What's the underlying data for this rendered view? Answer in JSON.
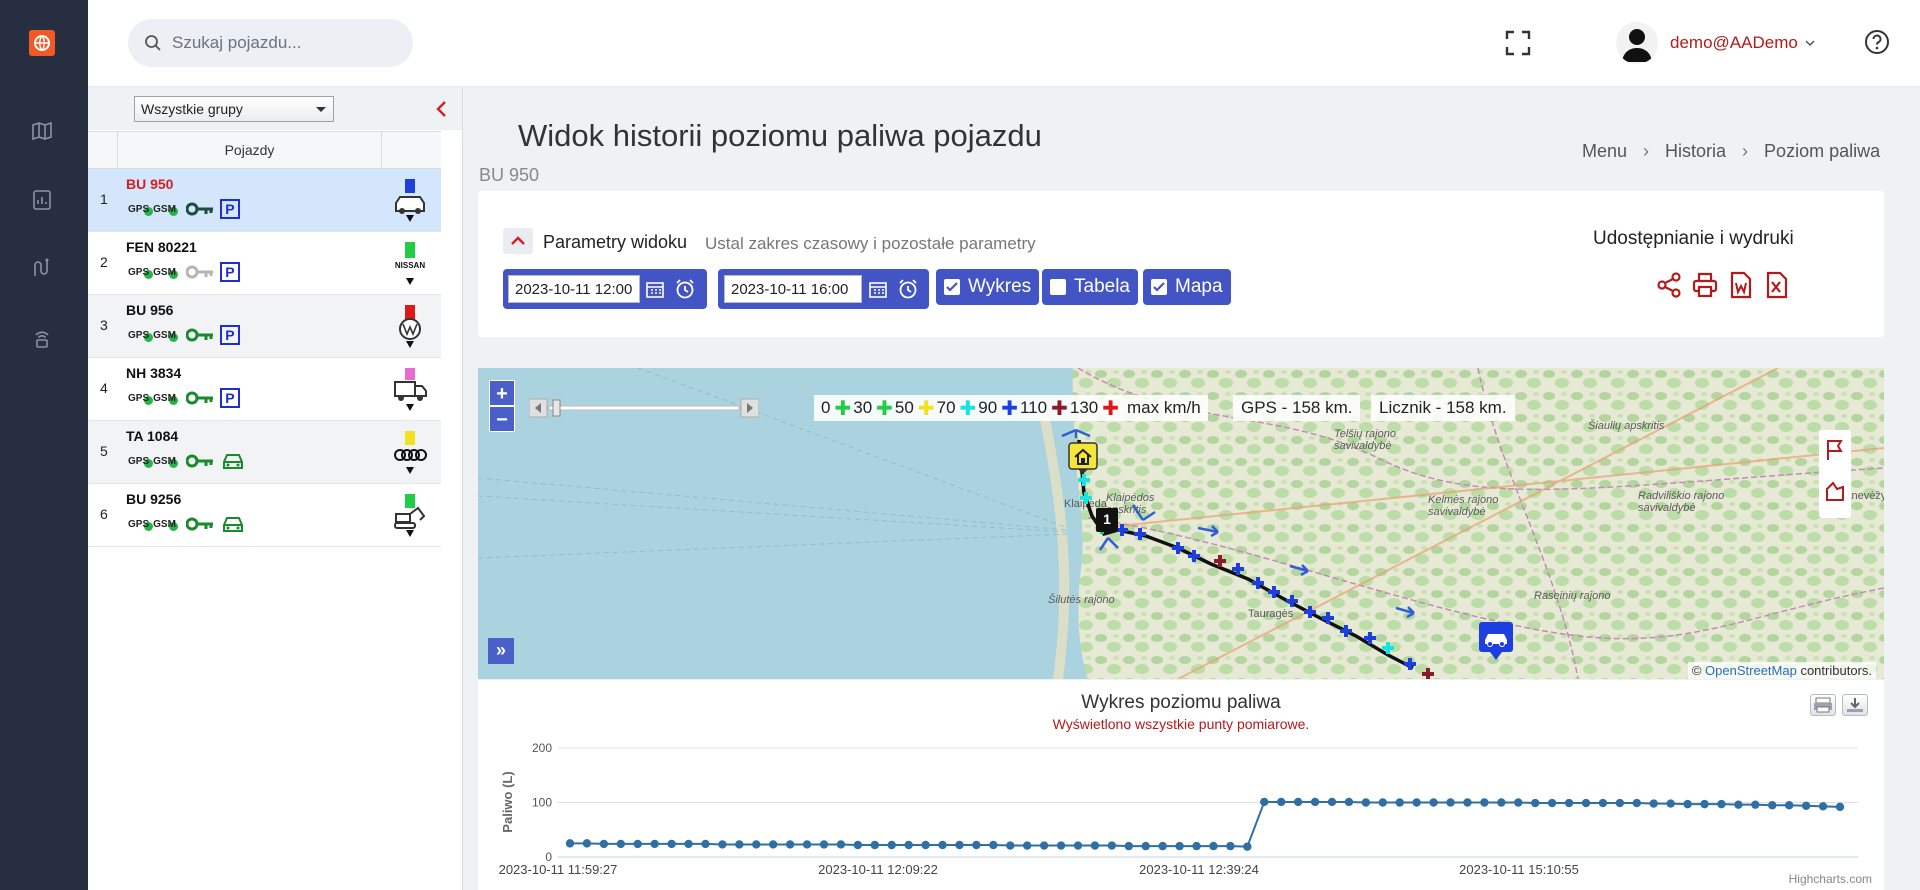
{
  "topbar": {
    "search_placeholder": "Szukaj pojazdu...",
    "user_name": "demo",
    "user_domain": "@AADemo"
  },
  "vehicles": {
    "group_select": "Wszystkie grupy",
    "column_header": "Pojazdy",
    "rows": [
      {
        "num": "1",
        "plate": "BU 950",
        "key_color": "#1b4d3e",
        "status": "P",
        "brand": "car-blue"
      },
      {
        "num": "2",
        "plate": "FEN 80221",
        "key_color": "#b5b5b5",
        "status": "P",
        "brand": "nissan"
      },
      {
        "num": "3",
        "plate": "BU 956",
        "key_color": "#1a8a2e",
        "status": "P",
        "brand": "vw"
      },
      {
        "num": "4",
        "plate": "NH 3834",
        "key_color": "#1a8a2e",
        "status": "P",
        "brand": "truck"
      },
      {
        "num": "5",
        "plate": "TA 1084",
        "key_color": "#1a8a2e",
        "status": "car",
        "brand": "audi"
      },
      {
        "num": "6",
        "plate": "BU 9256",
        "key_color": "#1a8a2e",
        "status": "car",
        "brand": "excavator"
      }
    ],
    "tag_gps": "GPS",
    "tag_gsm": "GSM"
  },
  "page": {
    "title": "Widok historii poziomu paliwa pojazdu",
    "subtitle": "BU 950",
    "breadcrumb": [
      "Menu",
      "Historia",
      "Poziom paliwa"
    ]
  },
  "params": {
    "title": "Parametry widoku",
    "description": "Ustal zakres czasowy i pozostałe parametry",
    "date_from": "2023-10-11 12:00",
    "date_to": "2023-10-11 16:00",
    "chk_chart": "Wykres",
    "chk_chart_checked": true,
    "chk_table": "Tabela",
    "chk_table_checked": false,
    "chk_map": "Mapa",
    "chk_map_checked": true,
    "share_title": "Udostępnianie i wydruki"
  },
  "map": {
    "legend": [
      {
        "label": "0",
        "color": "#22cc44"
      },
      {
        "label": "30",
        "color": "#22cc44"
      },
      {
        "label": "50",
        "color": "#f2e11e"
      },
      {
        "label": "70",
        "color": "#18e3e3"
      },
      {
        "label": "90",
        "color": "#1d3fe0"
      },
      {
        "label": "110",
        "color": "#8b1a2b"
      },
      {
        "label": "130",
        "color": "#e01818"
      }
    ],
    "legend_suffix": "max km/h",
    "gps_distance": "GPS - 158 km.",
    "odometer_distance": "Licznik - 158 km.",
    "labels": {
      "klaipeda_region": "Klaipėdos apskritis",
      "klaipeda": "Klaipėda",
      "siauliai": "Šiaulių apskritis",
      "telsiai": "Telšių rajono savivaldybė",
      "kelme": "Kelmės rajono savivaldybė",
      "radviliskis": "Radviliškio rajono savivaldybė",
      "panevezys": "Panevėžys",
      "silute": "Šilutės rajono",
      "taurage": "Tauragės",
      "raseiniai": "Raseinių rajono"
    },
    "attribution_prefix": "©",
    "attribution_link": "OpenStreetMap",
    "attribution_suffix": "contributors.",
    "marker_number": "1"
  },
  "chart_data": {
    "type": "line",
    "title": "Wykres poziomu paliwa",
    "subtitle": "Wyświetlono wszystkie punty pomiarowe.",
    "ylabel": "Paliwo (L)",
    "ylim": [
      0,
      200
    ],
    "yticks": [
      0,
      100,
      200
    ],
    "xtick_labels": [
      "2023-10-11 11:59:27",
      "2023-10-11 12:09:22",
      "2023-10-11 12:39:24",
      "2023-10-11 15:10:55"
    ],
    "series": [
      {
        "color": "#2f6fa3",
        "values": [
          25,
          25,
          24,
          24,
          24,
          24,
          24,
          24,
          24,
          23,
          23,
          23,
          23,
          23,
          23,
          23,
          23,
          22,
          22,
          22,
          22,
          22,
          22,
          22,
          22,
          22,
          21,
          21,
          21,
          21,
          21,
          21,
          21,
          20,
          20,
          20,
          20,
          20,
          20,
          20,
          19,
          101,
          101,
          101,
          101,
          101,
          101,
          100,
          100,
          100,
          100,
          100,
          100,
          100,
          100,
          100,
          100,
          99,
          99,
          99,
          99,
          99,
          99,
          99,
          98,
          98,
          97,
          97,
          97,
          96,
          96,
          95,
          95,
          94,
          93,
          92
        ]
      }
    ],
    "credit": "Highcharts.com"
  }
}
